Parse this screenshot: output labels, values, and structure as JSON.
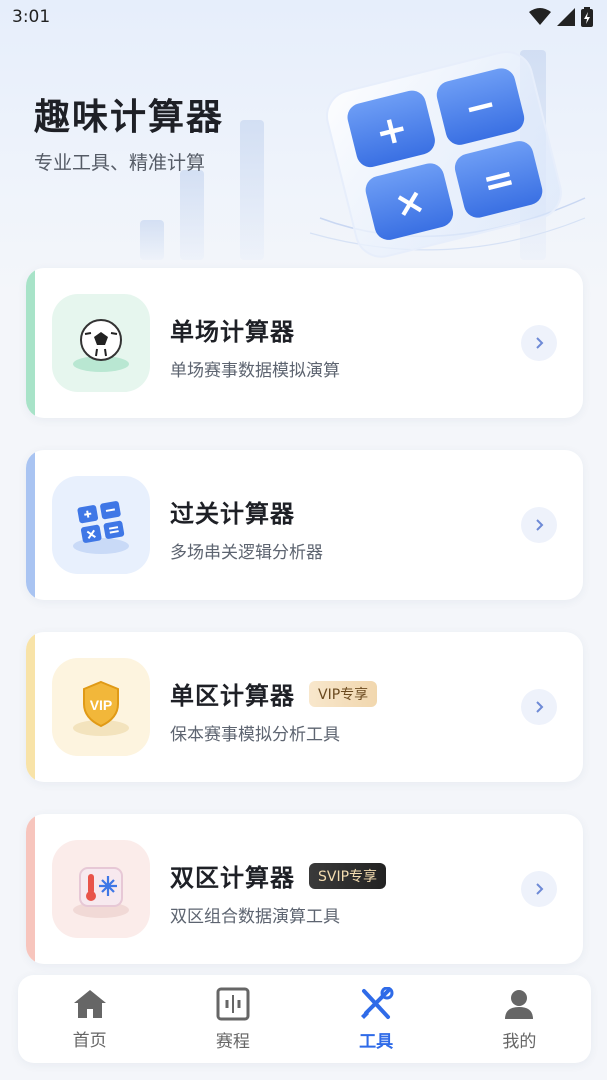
{
  "status_bar": {
    "time": "3:01"
  },
  "header": {
    "title": "趣味计算器",
    "subtitle": "专业工具、精准计算"
  },
  "hero_illustration": {
    "keys": [
      "+",
      "−",
      "×",
      "="
    ]
  },
  "colors": {
    "accent_blue": "#2f6be8",
    "card_green": "#a8e3c8",
    "card_blue": "#a9c4f2",
    "card_yellow": "#f8e3a8",
    "card_red": "#f7c5bd"
  },
  "cards": [
    {
      "title": "单场计算器",
      "desc": "单场赛事数据模拟演算",
      "badge": "",
      "icon": "soccer-ball-icon"
    },
    {
      "title": "过关计算器",
      "desc": "多场串关逻辑分析器",
      "badge": "",
      "icon": "calculator-icon"
    },
    {
      "title": "单区计算器",
      "desc": "保本赛事模拟分析工具",
      "badge": "VIP专享",
      "icon": "vip-shield-icon"
    },
    {
      "title": "双区计算器",
      "desc": "双区组合数据演算工具",
      "badge": "SVIP专享",
      "icon": "thermo-snowflake-icon"
    }
  ],
  "tabbar": {
    "items": [
      {
        "label": "首页",
        "icon": "home-icon",
        "active": false
      },
      {
        "label": "赛程",
        "icon": "schedule-icon",
        "active": false
      },
      {
        "label": "工具",
        "icon": "tools-icon",
        "active": true
      },
      {
        "label": "我的",
        "icon": "profile-icon",
        "active": false
      }
    ]
  }
}
